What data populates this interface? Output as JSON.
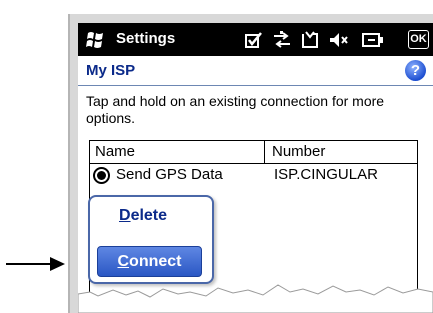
{
  "titlebar": {
    "title": "Settings",
    "ok_label": "OK",
    "icons": [
      "windows-logo-icon",
      "checkbox-icon",
      "connectivity-icon",
      "battery-icon",
      "speaker-muted-icon",
      "power-icon"
    ]
  },
  "header": {
    "title": "My ISP",
    "help_label": "?"
  },
  "instructions": "Tap and hold on an existing connection for more options.",
  "table": {
    "columns": [
      "Name",
      "Number"
    ],
    "rows": [
      {
        "name": "Send GPS Data",
        "number": "ISP.CINGULAR",
        "selected": true
      }
    ]
  },
  "context_menu": {
    "items": [
      "Delete",
      "Connect"
    ],
    "highlighted": "Connect"
  },
  "colors": {
    "titlebar": "#000000",
    "header_text": "#0b2a8a",
    "highlight": "#2a57c4"
  }
}
